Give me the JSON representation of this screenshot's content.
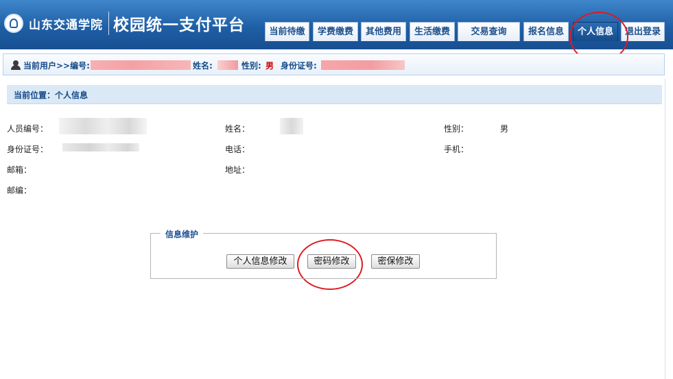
{
  "header": {
    "school_name": "山东交通学院",
    "platform_title": "校园统一支付平台",
    "nav_tabs": [
      {
        "label": "当前待缴"
      },
      {
        "label": "学费缴费"
      },
      {
        "label": "其他费用"
      },
      {
        "label": "生活缴费"
      },
      {
        "label": "交易查询"
      },
      {
        "label": "报名信息"
      },
      {
        "label": "个人信息",
        "active": true
      },
      {
        "label": "退出登录"
      }
    ]
  },
  "userbar": {
    "current_user_label": "当前用户>>编号:",
    "name_label": "姓名:",
    "gender_label": "性别:",
    "gender_value": "男",
    "id_label": "身份证号:"
  },
  "location": {
    "text": "当前位置：个人信息"
  },
  "profile": {
    "staff_no_label": "人员编号：",
    "name_label": "姓名：",
    "gender_label": "性别：",
    "gender_value": "男",
    "id_label": "身份证号：",
    "phone_label": "电话：",
    "mobile_label": "手机：",
    "email_label": "邮箱：",
    "address_label": "地址：",
    "zip_label": "邮编："
  },
  "maintenance": {
    "legend": "信息维护",
    "edit_info_button": "个人信息修改",
    "change_password_button": "密码修改",
    "security_question_button": "密保修改"
  },
  "colors": {
    "header_blue": "#1f5fa6",
    "accent_text": "#154a8a",
    "highlight_red": "#e0191f"
  }
}
